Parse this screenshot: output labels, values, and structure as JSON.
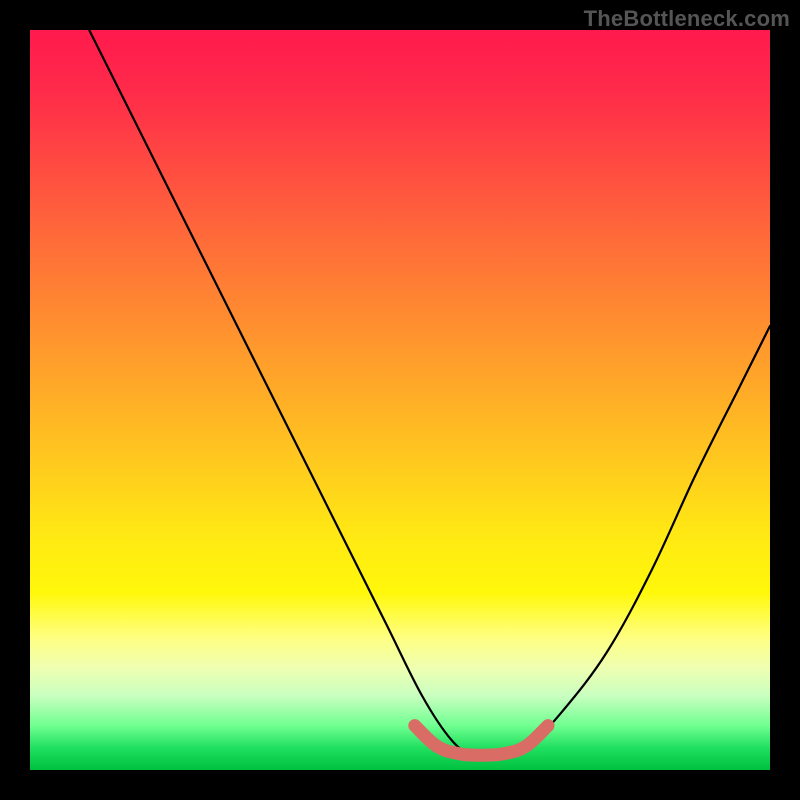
{
  "watermark": "TheBottleneck.com",
  "colors": {
    "background": "#000000",
    "curve": "#000000",
    "marker": "#d96c64",
    "gradient_top": "#ff1a4d",
    "gradient_bottom": "#00c040"
  },
  "chart_data": {
    "type": "line",
    "title": "",
    "xlabel": "",
    "ylabel": "",
    "xlim": [
      0,
      100
    ],
    "ylim": [
      0,
      100
    ],
    "grid": false,
    "legend": false,
    "series": [
      {
        "name": "bottleneck-curve",
        "x": [
          8,
          15,
          22,
          30,
          36,
          42,
          48,
          53,
          57,
          60,
          64,
          68,
          72,
          78,
          84,
          90,
          96,
          100
        ],
        "values": [
          100,
          86,
          72,
          56,
          44,
          32,
          20,
          10,
          4,
          2,
          2,
          4,
          8,
          16,
          27,
          40,
          52,
          60
        ]
      }
    ],
    "highlight": {
      "name": "optimal-range",
      "x": [
        52,
        55,
        58,
        61,
        64,
        67,
        70
      ],
      "values": [
        6,
        3.2,
        2.2,
        2,
        2.2,
        3.2,
        6
      ]
    }
  }
}
